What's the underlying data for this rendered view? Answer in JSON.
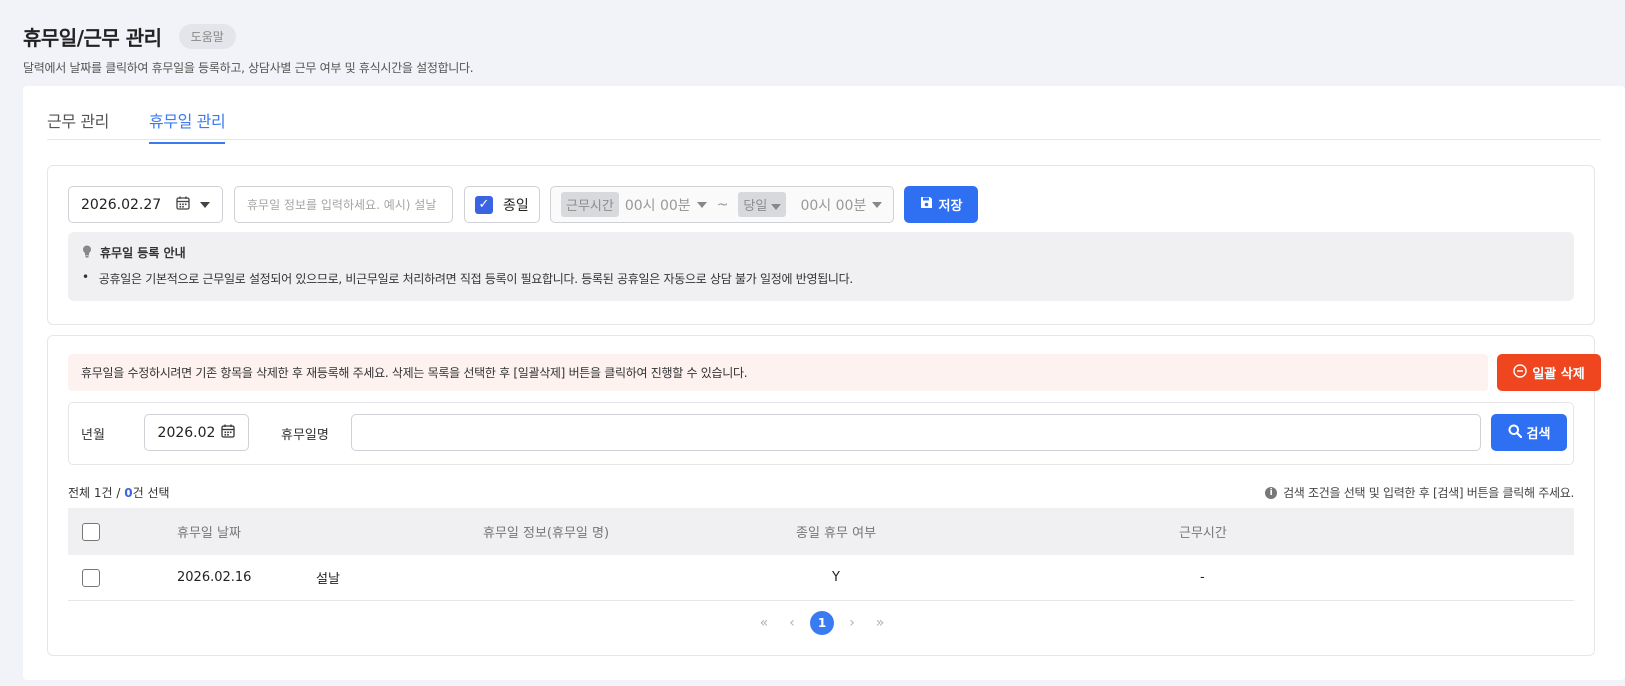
{
  "header": {
    "title": "휴무일/근무 관리",
    "help_label": "도움말",
    "description": "달력에서 날짜를 클릭하여 휴무일을 등록하고, 상담사별 근무 여부 및 휴식시간을 설정합니다."
  },
  "tabs": [
    {
      "label": "근무 관리",
      "active": false
    },
    {
      "label": "휴무일 관리",
      "active": true
    }
  ],
  "register": {
    "date_value": "2026.02.27",
    "info_placeholder": "휴무일 정보를 입력하세요. 예시) 설날",
    "allday_label": "종일",
    "allday_checked": true,
    "work_time_label": "근무시간",
    "start_time": "00시 00분",
    "tilde": "~",
    "same_day_label": "당일",
    "end_time": "00시 00분",
    "save_label": "저장",
    "guide_title": "휴무일 등록 안내",
    "guide_items": [
      "공휴일은 기본적으로 근무일로 설정되어 있으므로, 비근무일로 처리하려면 직접 등록이 필요합니다. 등록된 공휴일은 자동으로 상담 불가 일정에 반영됩니다."
    ]
  },
  "list": {
    "notice": "휴무일을 수정하시려면 기존 항목을 삭제한 후 재등록해 주세요. 삭제는 목록을 선택한 후 [일괄삭제] 버튼을 클릭하여 진행할 수 있습니다.",
    "bulk_delete_label": "일괄 삭제",
    "search": {
      "month_label": "년월",
      "month_value": "2026.02",
      "name_label": "휴무일명",
      "name_value": "",
      "search_label": "검색"
    },
    "count_prefix": "전체 1건 / ",
    "selected_count": "0",
    "count_suffix": "건 선택",
    "hint": "검색 조건을 선택 및 입력한 후 [검색] 버튼을 클릭해 주세요.",
    "columns": [
      "휴무일 날짜",
      "휴무일 정보(휴무일 명)",
      "종일 휴무 여부",
      "근무시간"
    ],
    "rows": [
      {
        "date": "2026.02.16",
        "info": "설날",
        "allday": "Y",
        "work_time": "-"
      }
    ],
    "pagination": {
      "first": "«",
      "prev": "‹",
      "current": "1",
      "next": "›",
      "last": "»"
    }
  },
  "colors": {
    "accent": "#3b7bf2",
    "button_blue": "#2f6ff2",
    "danger": "#f0461f",
    "notice_bg": "#fdf2f0"
  },
  "icons": [
    "calendar-icon",
    "floppy-icon",
    "lightbulb-icon",
    "minus-circle-icon",
    "search-icon",
    "info-icon"
  ]
}
